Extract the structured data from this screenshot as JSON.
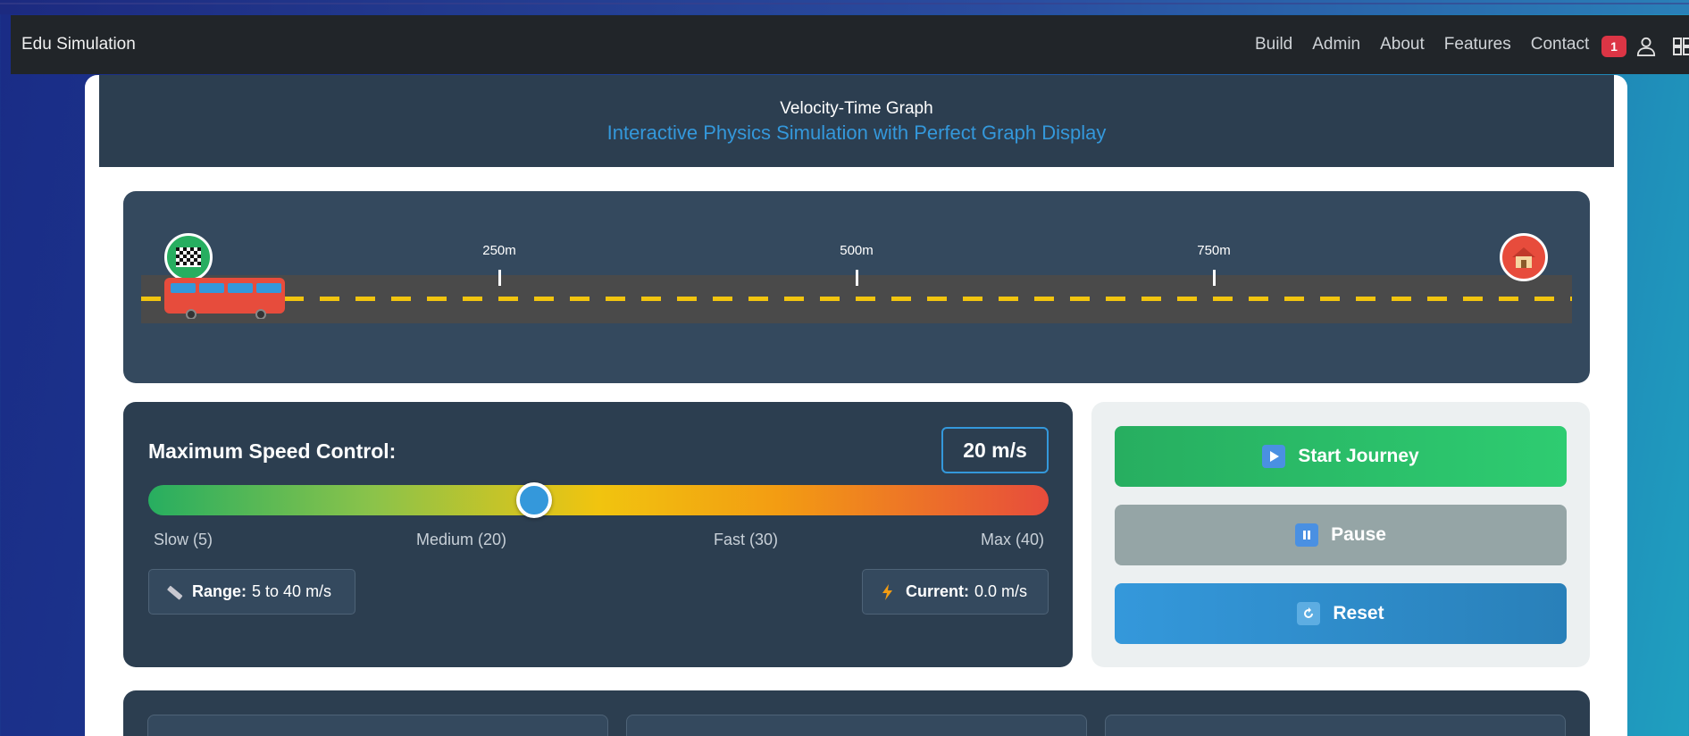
{
  "navbar": {
    "brand": "Edu Simulation",
    "links": [
      "Build",
      "Admin",
      "About",
      "Features",
      "Contact"
    ],
    "notification_count": "1"
  },
  "header": {
    "title": "Velocity-Time Graph",
    "subtitle": "Interactive Physics Simulation with Perfect Graph Display"
  },
  "track": {
    "markers": [
      "250m",
      "500m",
      "750m"
    ],
    "start_icon": "checkered-flag-icon",
    "end_icon": "house-icon"
  },
  "speed": {
    "title": "Maximum Speed Control:",
    "value_display": "20 m/s",
    "slider": {
      "min": 5,
      "max": 40,
      "value": 20
    },
    "labels": [
      "Slow (5)",
      "Medium (20)",
      "Fast (30)",
      "Max (40)"
    ],
    "range_label": "Range:",
    "range_value": "5 to 40 m/s",
    "current_label": "Current:",
    "current_value": "0.0 m/s"
  },
  "controls": {
    "start": "Start Journey",
    "pause": "Pause",
    "reset": "Reset"
  },
  "colors": {
    "nav_bg": "#212529",
    "header_bg": "#2c3e50",
    "accent_blue": "#3498db",
    "start_green": "#27ae60",
    "pause_gray": "#95a5a6",
    "badge_red": "#dc3545"
  }
}
